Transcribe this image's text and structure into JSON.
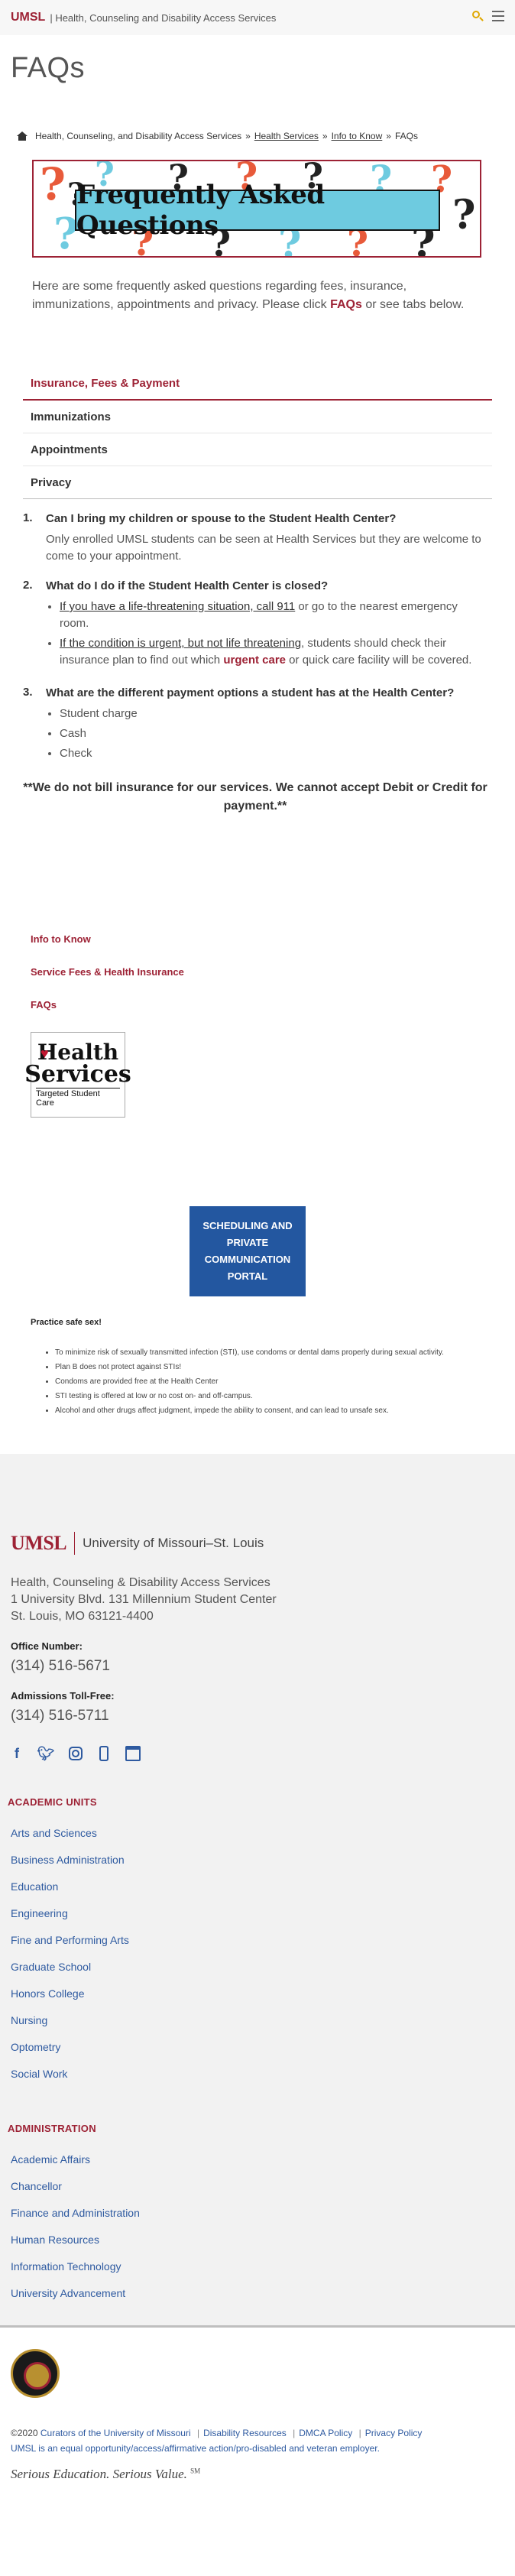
{
  "header": {
    "brand": "UMSL",
    "site_name": "| Health, Counseling and Disability Access Services"
  },
  "page_title": "FAQs",
  "breadcrumb": {
    "items": [
      "Health, Counseling, and Disability Access Services",
      "Health Services",
      "Info to Know",
      "FAQs"
    ],
    "separator": "»"
  },
  "banner": {
    "text": "Frequently Asked Questions"
  },
  "intro": {
    "text_before": "Here are some frequently asked questions regarding fees, insurance, immunizations, appointments and privacy. Please click ",
    "link": "FAQs",
    "text_after": " or see tabs below."
  },
  "tabs": [
    "Insurance, Fees & Payment",
    "Immunizations",
    "Appointments",
    "Privacy"
  ],
  "faq": {
    "q1": {
      "num": "1.",
      "question": "Can I bring my children or spouse to the Student Health Center?",
      "answer": "Only enrolled UMSL students can be seen at Health Services but they are welcome to come to your appointment."
    },
    "q2": {
      "num": "2.",
      "question": "What do I do if the Student Health Center is closed?",
      "b1_link": "If you have a life-threatening situation, call 911",
      "b1_rest": " or go to the nearest emergency room.",
      "b2_link": "If the condition is urgent, but not life threatening",
      "b2_mid": ", students should check their insurance plan to find out which ",
      "b2_red": "urgent care",
      "b2_rest": " or quick care facility will be covered."
    },
    "q3": {
      "num": "3.",
      "question": "What are the different payment options a student has at the Health Center?",
      "options": [
        "Student charge",
        "Cash",
        "Check"
      ]
    }
  },
  "notice": "**We do not bill insurance for our services.  We cannot accept Debit or Credit for payment.**",
  "side_links": [
    "Info to Know",
    "Service Fees & Health Insurance",
    "FAQs"
  ],
  "health_logo": {
    "line1": "Health",
    "line2": "Services",
    "tagline": "Targeted Student Care"
  },
  "portal_button": "SCHEDULING AND PRIVATE COMMUNICATION PORTAL",
  "safe_sex": {
    "title": "Practice safe sex!",
    "items": [
      "To minimize risk of sexually transmitted infection (STI), use condoms or dental dams properly during sexual activity.",
      "Plan B does not protect against STIs!",
      "Condoms are provided free at the Health Center",
      "STI testing is offered at low or no cost on- and off-campus.",
      "Alcohol and other drugs affect judgment, impede the ability to consent, and can lead to unsafe sex."
    ]
  },
  "footer": {
    "logo": "UMSL",
    "university": "University of Missouri–St. Louis",
    "address": [
      "Health, Counseling & Disability Access Services",
      "1 University Blvd. 131 Millennium Student Center",
      "St. Louis, MO 63121-4400"
    ],
    "office_label": "Office Number:",
    "office_phone": "(314) 516-5671",
    "admissions_label": "Admissions Toll-Free:",
    "admissions_phone": "(314) 516-5711",
    "social": [
      "facebook-icon",
      "twitter-icon",
      "instagram-icon",
      "mobile-icon",
      "calendar-icon"
    ],
    "academic_title": "ACADEMIC UNITS",
    "academic_units": [
      "Arts and Sciences",
      "Business Administration",
      "Education",
      "Engineering",
      "Fine and Performing Arts",
      "Graduate School",
      "Honors College",
      "Nursing",
      "Optometry",
      "Social Work"
    ],
    "admin_title": "ADMINISTRATION",
    "administration": [
      "Academic Affairs",
      "Chancellor",
      "Finance and Administration",
      "Human Resources",
      "Information Technology",
      "University Advancement"
    ]
  },
  "legal": {
    "copyright_prefix": "©2020 ",
    "curators": "Curators of the University of Missouri",
    "links": [
      "Disability Resources",
      "DMCA Policy",
      "Privacy Policy"
    ],
    "eeo": "UMSL is an equal opportunity/access/affirmative action/pro-disabled and veteran employer.",
    "slogan": "Serious Education. Serious Value.",
    "sm": "SM"
  },
  "colors": {
    "accent": "#9d2235",
    "link_blue": "#2e5aa0",
    "portal_blue": "#2357a0",
    "banner_band": "#6ecbe0"
  }
}
